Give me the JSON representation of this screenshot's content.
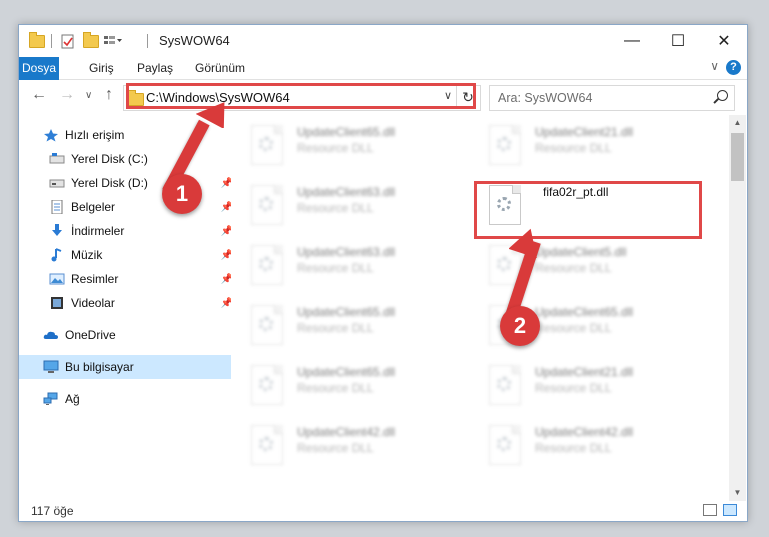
{
  "window": {
    "title": "SysWOW64",
    "minimize": "—",
    "maximize": "☐",
    "close": "✕"
  },
  "ribbon": {
    "tabs": [
      "Dosya",
      "Giriş",
      "Paylaş",
      "Görünüm"
    ],
    "collapse": "∨",
    "help": "?"
  },
  "navbar": {
    "back": "←",
    "forward": "→",
    "recent": "∨",
    "up": "↑",
    "address": "C:\\Windows\\SysWOW64",
    "address_dropdown": "∨",
    "refresh": "↻",
    "search_placeholder": "Ara: SysWOW64"
  },
  "sidebar": {
    "items": [
      {
        "label": "Hızlı erişim",
        "icon": "star-icon"
      },
      {
        "label": "Yerel Disk (C:)",
        "icon": "drive-icon"
      },
      {
        "label": "Yerel Disk (D:)",
        "icon": "drive-icon"
      },
      {
        "label": "Belgeler",
        "icon": "documents-icon"
      },
      {
        "label": "İndirmeler",
        "icon": "download-icon"
      },
      {
        "label": "Müzik",
        "icon": "music-icon"
      },
      {
        "label": "Resimler",
        "icon": "pictures-icon"
      },
      {
        "label": "Videolar",
        "icon": "videos-icon"
      },
      {
        "label": "OneDrive",
        "icon": "cloud-icon"
      },
      {
        "label": "Bu bilgisayar",
        "icon": "computer-icon"
      },
      {
        "label": "Ağ",
        "icon": "network-icon"
      }
    ]
  },
  "files": {
    "left": [
      {
        "name": "UpdateClient65.dll",
        "type": "Resource DLL"
      },
      {
        "name": "UpdateClient63.dll",
        "type": "Resource DLL"
      },
      {
        "name": "UpdateClient63.dll",
        "type": "Resource DLL"
      },
      {
        "name": "UpdateClient65.dll",
        "type": "Resource DLL"
      },
      {
        "name": "UpdateClient65.dll",
        "type": "Resource DLL"
      },
      {
        "name": "UpdateClient42.dll",
        "type": "Resource DLL"
      }
    ],
    "right": [
      {
        "name": "UpdateClient21.dll",
        "type": "Resource DLL"
      },
      {
        "name": "fifa02r_pt.dll",
        "type": ""
      },
      {
        "name": "UpdateClient5.dll",
        "type": "Resource DLL"
      },
      {
        "name": "UpdateClient65.dll",
        "type": "Resource DLL"
      },
      {
        "name": "UpdateClient21.dll",
        "type": "Resource DLL"
      },
      {
        "name": "UpdateClient42.dll",
        "type": "Resource DLL"
      }
    ]
  },
  "status": {
    "count": "117 öğe"
  },
  "callouts": {
    "one": "1",
    "two": "2"
  }
}
